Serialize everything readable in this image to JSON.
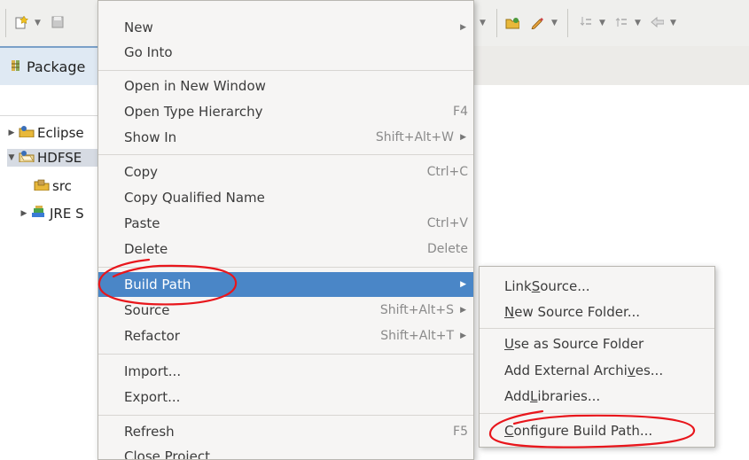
{
  "package_explorer": {
    "tab_label": "Package",
    "tree": [
      {
        "label": "Eclipse",
        "expanded": false
      },
      {
        "label": "HDFSE",
        "expanded": true
      },
      {
        "label": "src"
      },
      {
        "label": "JRE S",
        "expanded": false
      }
    ]
  },
  "context_menu": {
    "items": [
      {
        "label": "New",
        "submenu": true
      },
      {
        "label": "Go Into"
      },
      {
        "label": "Open in New Window"
      },
      {
        "label": "Open Type Hierarchy",
        "shortcut": "F4"
      },
      {
        "label": "Show In",
        "shortcut": "Shift+Alt+W",
        "submenu": true
      },
      {
        "label": "Copy",
        "shortcut": "Ctrl+C"
      },
      {
        "label": "Copy Qualified Name"
      },
      {
        "label": "Paste",
        "shortcut": "Ctrl+V"
      },
      {
        "label": "Delete",
        "shortcut": "Delete"
      },
      {
        "label": "Build Path",
        "submenu": true,
        "highlighted": true
      },
      {
        "label": "Source",
        "shortcut": "Shift+Alt+S",
        "submenu": true
      },
      {
        "label": "Refactor",
        "shortcut": "Shift+Alt+T",
        "submenu": true
      },
      {
        "label": "Import..."
      },
      {
        "label": "Export..."
      },
      {
        "label": "Refresh",
        "shortcut": "F5"
      },
      {
        "label": "Close Project"
      }
    ]
  },
  "build_path_submenu": {
    "link_source": {
      "pre": "Link ",
      "mn": "S",
      "post": "ource..."
    },
    "new_source_folder": {
      "pre": "",
      "mn": "N",
      "post": "ew Source Folder..."
    },
    "use_as_source_folder": {
      "pre": "",
      "mn": "U",
      "post": "se as Source Folder"
    },
    "add_external_archives": {
      "pre": "Add External Archi",
      "mn": "v",
      "post": "es..."
    },
    "add_libraries": {
      "pre": "Add ",
      "mn": "L",
      "post": "ibraries..."
    },
    "configure_build_path": {
      "pre": "",
      "mn": "C",
      "post": "onfigure Build Path..."
    }
  },
  "colors": {
    "menu_highlight": "#4a86c7",
    "annotation": "#e8161c"
  }
}
